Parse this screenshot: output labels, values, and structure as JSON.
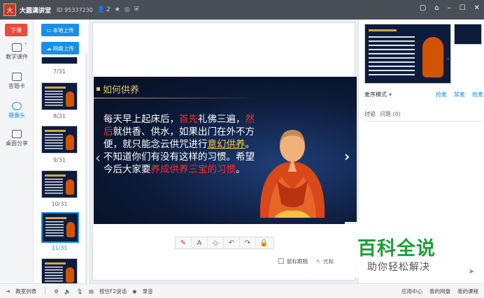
{
  "titlebar": {
    "logo_text": "大",
    "room_name": "大圆满讲堂",
    "room_id": "ID 95337230",
    "user_count": "2",
    "icons": [
      "user-icon",
      "star-icon",
      "refresh-icon",
      "shield-icon"
    ],
    "window_controls": [
      "restore-icon",
      "skin-icon",
      "minimize-icon",
      "maximize-icon",
      "close-icon"
    ]
  },
  "leftnav": {
    "down_button": "下课",
    "items": [
      {
        "label": "教学课件",
        "icon": "courseware-icon"
      },
      {
        "label": "答题卡",
        "icon": "answer-card-icon"
      },
      {
        "label": "摄像头",
        "icon": "camera-icon"
      },
      {
        "label": "桌面分享",
        "icon": "screen-share-icon"
      }
    ]
  },
  "thumbs": {
    "local_upload": "本地上传",
    "cloud_upload": "网盘上传",
    "labels": [
      "7/31",
      "8/31",
      "9/31",
      "10/31",
      "11/31"
    ],
    "selected": "11/31"
  },
  "slide": {
    "title": "如何供养",
    "line1_a": "每天早上起床后，",
    "line1_red": "首先",
    "line1_b": "礼佛三遍，",
    "line2_red": "然后",
    "line2_b": "就供香、供水，如果出门在外不方便，就只能念云供咒进行",
    "line3_gold": "意幻供养",
    "line3_b": "。不知道你们有没有这样的习惯。希望今后大家要",
    "line4_red": "养成供养三宝的习惯",
    "line4_b": "。"
  },
  "drawbar": {
    "tools": [
      "pen-icon",
      "text-icon",
      "eraser-icon",
      "undo-icon",
      "redo-icon",
      "lock-icon"
    ]
  },
  "cursorbar": {
    "follow_label": "鼠标跟随",
    "laser_label": "光标"
  },
  "rpanel": {
    "mode_label": "麦序模式",
    "links": [
      "抢麦",
      "禁麦",
      "抢麦"
    ],
    "discussion_label": "讨论",
    "question_label": "问题 (0)"
  },
  "watermark": {
    "title": "百科全说",
    "subtitle": "助你轻松解决"
  },
  "bottombar": {
    "left_items": [
      "教室列表",
      "按住F2说话",
      "录音"
    ],
    "right_items": [
      "应用中心",
      "我的网盘",
      "我的课程"
    ]
  }
}
